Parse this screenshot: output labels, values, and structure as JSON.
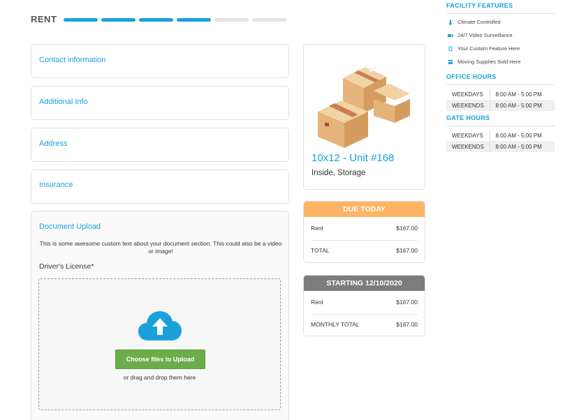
{
  "header": {
    "title": "RENT",
    "steps_total": 6,
    "steps_completed": 4
  },
  "sections": {
    "contact": "Contact information",
    "additional": "Additional Info",
    "address": "Address",
    "insurance": "Insurance",
    "document_upload": {
      "title": "Document Upload",
      "description": "This is some awesome custom text about your document section. This could also be a video or image!",
      "field_label": "Driver's License*",
      "upload_button": "Choose files to Upload",
      "drag_text": "or drag and drop them here"
    }
  },
  "unit": {
    "title": "10x12 - Unit #168",
    "subtitle": "Inside, Storage"
  },
  "due_today": {
    "header": "DUE TODAY",
    "rows": [
      {
        "label": "Rent",
        "value": "$167.00"
      },
      {
        "label": "TOTAL",
        "value": "$167.00"
      }
    ]
  },
  "starting": {
    "header": "STARTING 12/10/2020",
    "rows": [
      {
        "label": "Rent",
        "value": "$167.00"
      },
      {
        "label": "MONTHLY TOTAL",
        "value": "$167.00"
      }
    ]
  },
  "sidebar": {
    "features_title": "FACILITY FEATURES",
    "features": [
      {
        "label": "Climate Controlled",
        "icon": "thermometer-icon"
      },
      {
        "label": "24/7 Video Surveillance",
        "icon": "video-camera-icon"
      },
      {
        "label": "Your Custom Feature Here",
        "icon": "hand-icon"
      },
      {
        "label": "Moving Supplies Sold Here",
        "icon": "box-icon"
      }
    ],
    "office_title": "OFFICE HOURS",
    "office_hours": [
      {
        "day": "WEEKDAYS",
        "hours": "8:00 AM - 5:00 PM"
      },
      {
        "day": "WEEKENDS",
        "hours": "8:00 AM - 5:00 PM"
      }
    ],
    "gate_title": "GATE HOURS",
    "gate_hours": [
      {
        "day": "WEEKDAYS",
        "hours": "8:00 AM - 5:00 PM"
      },
      {
        "day": "WEEKENDS",
        "hours": "8:00 AM - 5:00 PM"
      }
    ]
  },
  "colors": {
    "accent": "#1aa1dc",
    "due_header": "#fdb465",
    "start_header": "#7c7c7c",
    "upload_button": "#6cad49"
  }
}
